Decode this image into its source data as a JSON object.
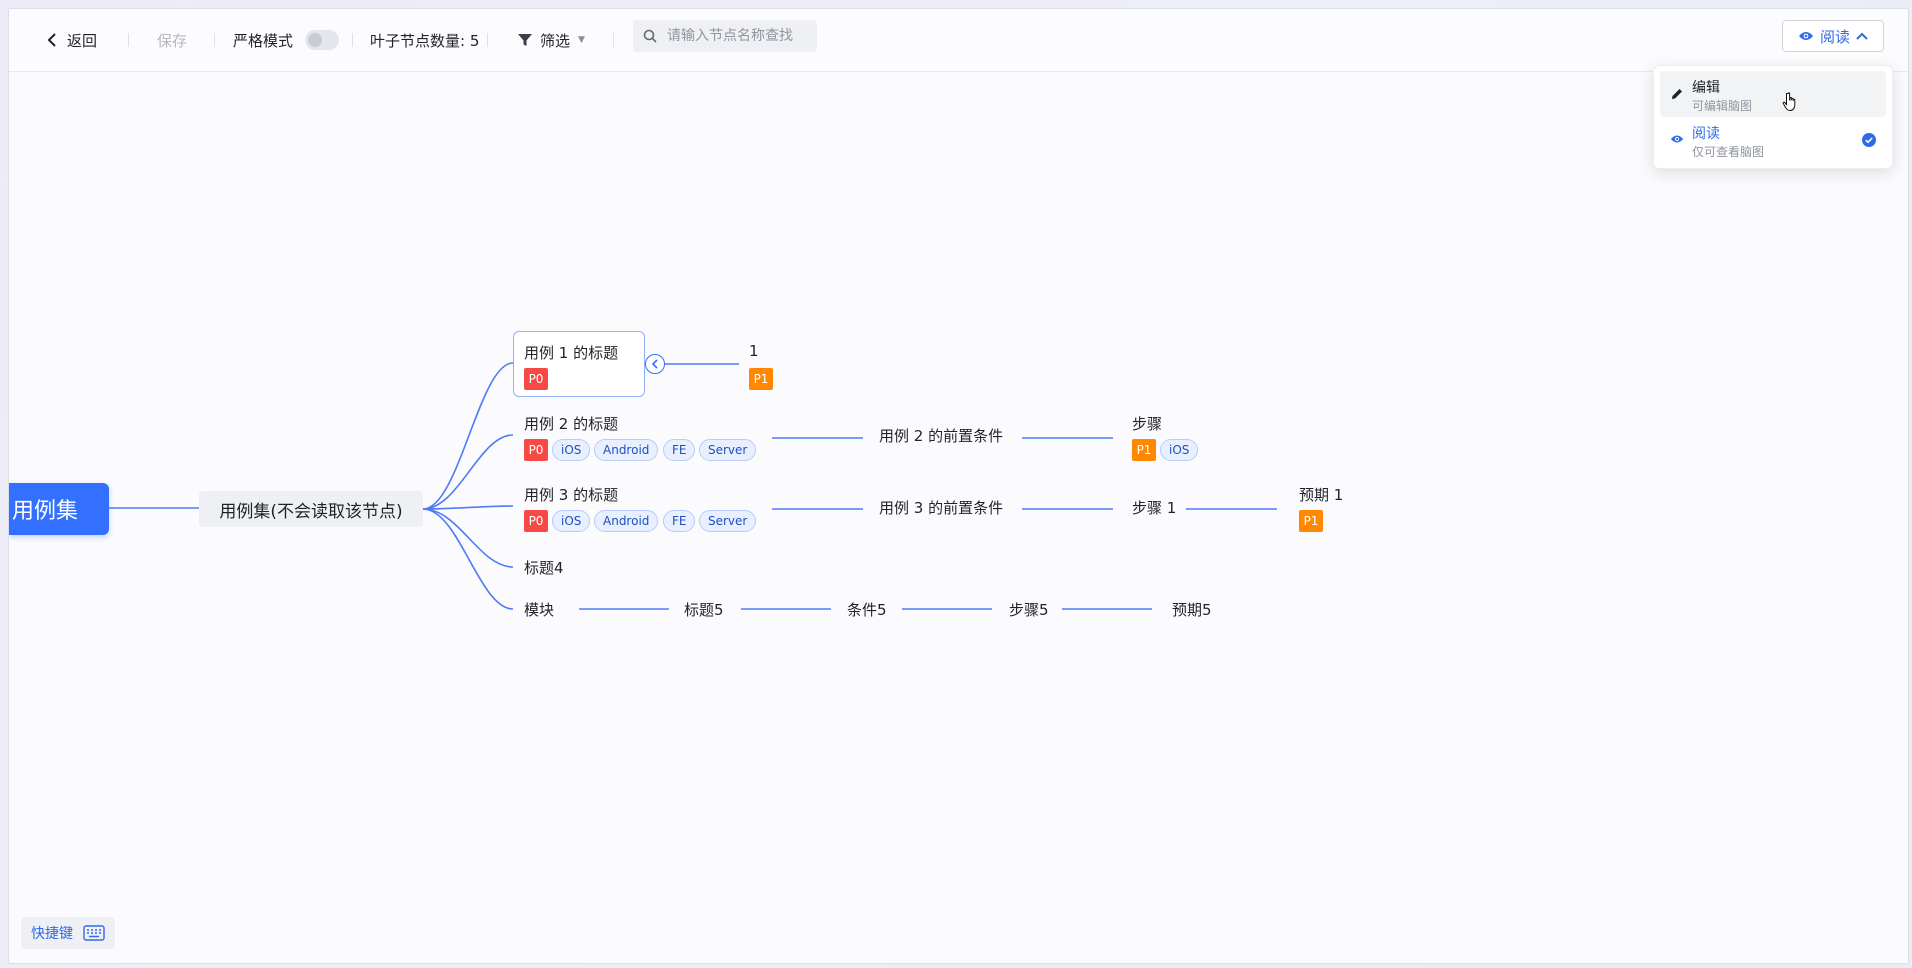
{
  "toolbar": {
    "back_label": "返回",
    "save_label": "保存",
    "strict_mode_label": "严格模式",
    "strict_mode_on": false,
    "leaf_count_label": "叶子节点数量: 5",
    "filter_label": "筛选",
    "search_placeholder": "请输入节点名称查找",
    "mode_label": "阅读"
  },
  "mode_menu": {
    "items": [
      {
        "title": "编辑",
        "subtitle": "可编辑脑图",
        "icon": "pencil-icon",
        "selected": false
      },
      {
        "title": "阅读",
        "subtitle": "仅可查看脑图",
        "icon": "eye-icon",
        "selected": true
      }
    ]
  },
  "mindmap": {
    "root": "用例集",
    "level1": "用例集(不会读取该节点)",
    "case1": {
      "title": "用例 1 的标题",
      "priority": "P0",
      "child": "1",
      "child_priority": "P1"
    },
    "case2": {
      "title": "用例 2 的标题",
      "priority": "P0",
      "tags": [
        "iOS",
        "Android",
        "FE",
        "Server"
      ],
      "precondition": "用例 2 的前置条件",
      "step": "步骤",
      "step_priority": "P1",
      "step_tag": "iOS"
    },
    "case3": {
      "title": "用例 3 的标题",
      "priority": "P0",
      "tags": [
        "iOS",
        "Android",
        "FE",
        "Server"
      ],
      "precondition": "用例 3 的前置条件",
      "step": "步骤 1",
      "expected": "预期 1",
      "expected_priority": "P1"
    },
    "node4": "标题4",
    "chain5": [
      "模块",
      "标题5",
      "条件5",
      "步骤5",
      "预期5"
    ]
  },
  "colors": {
    "accent": "#3370ff",
    "p0": "#f54a45",
    "p1": "#ff8800"
  },
  "footer": {
    "shortcut_label": "快捷键"
  }
}
